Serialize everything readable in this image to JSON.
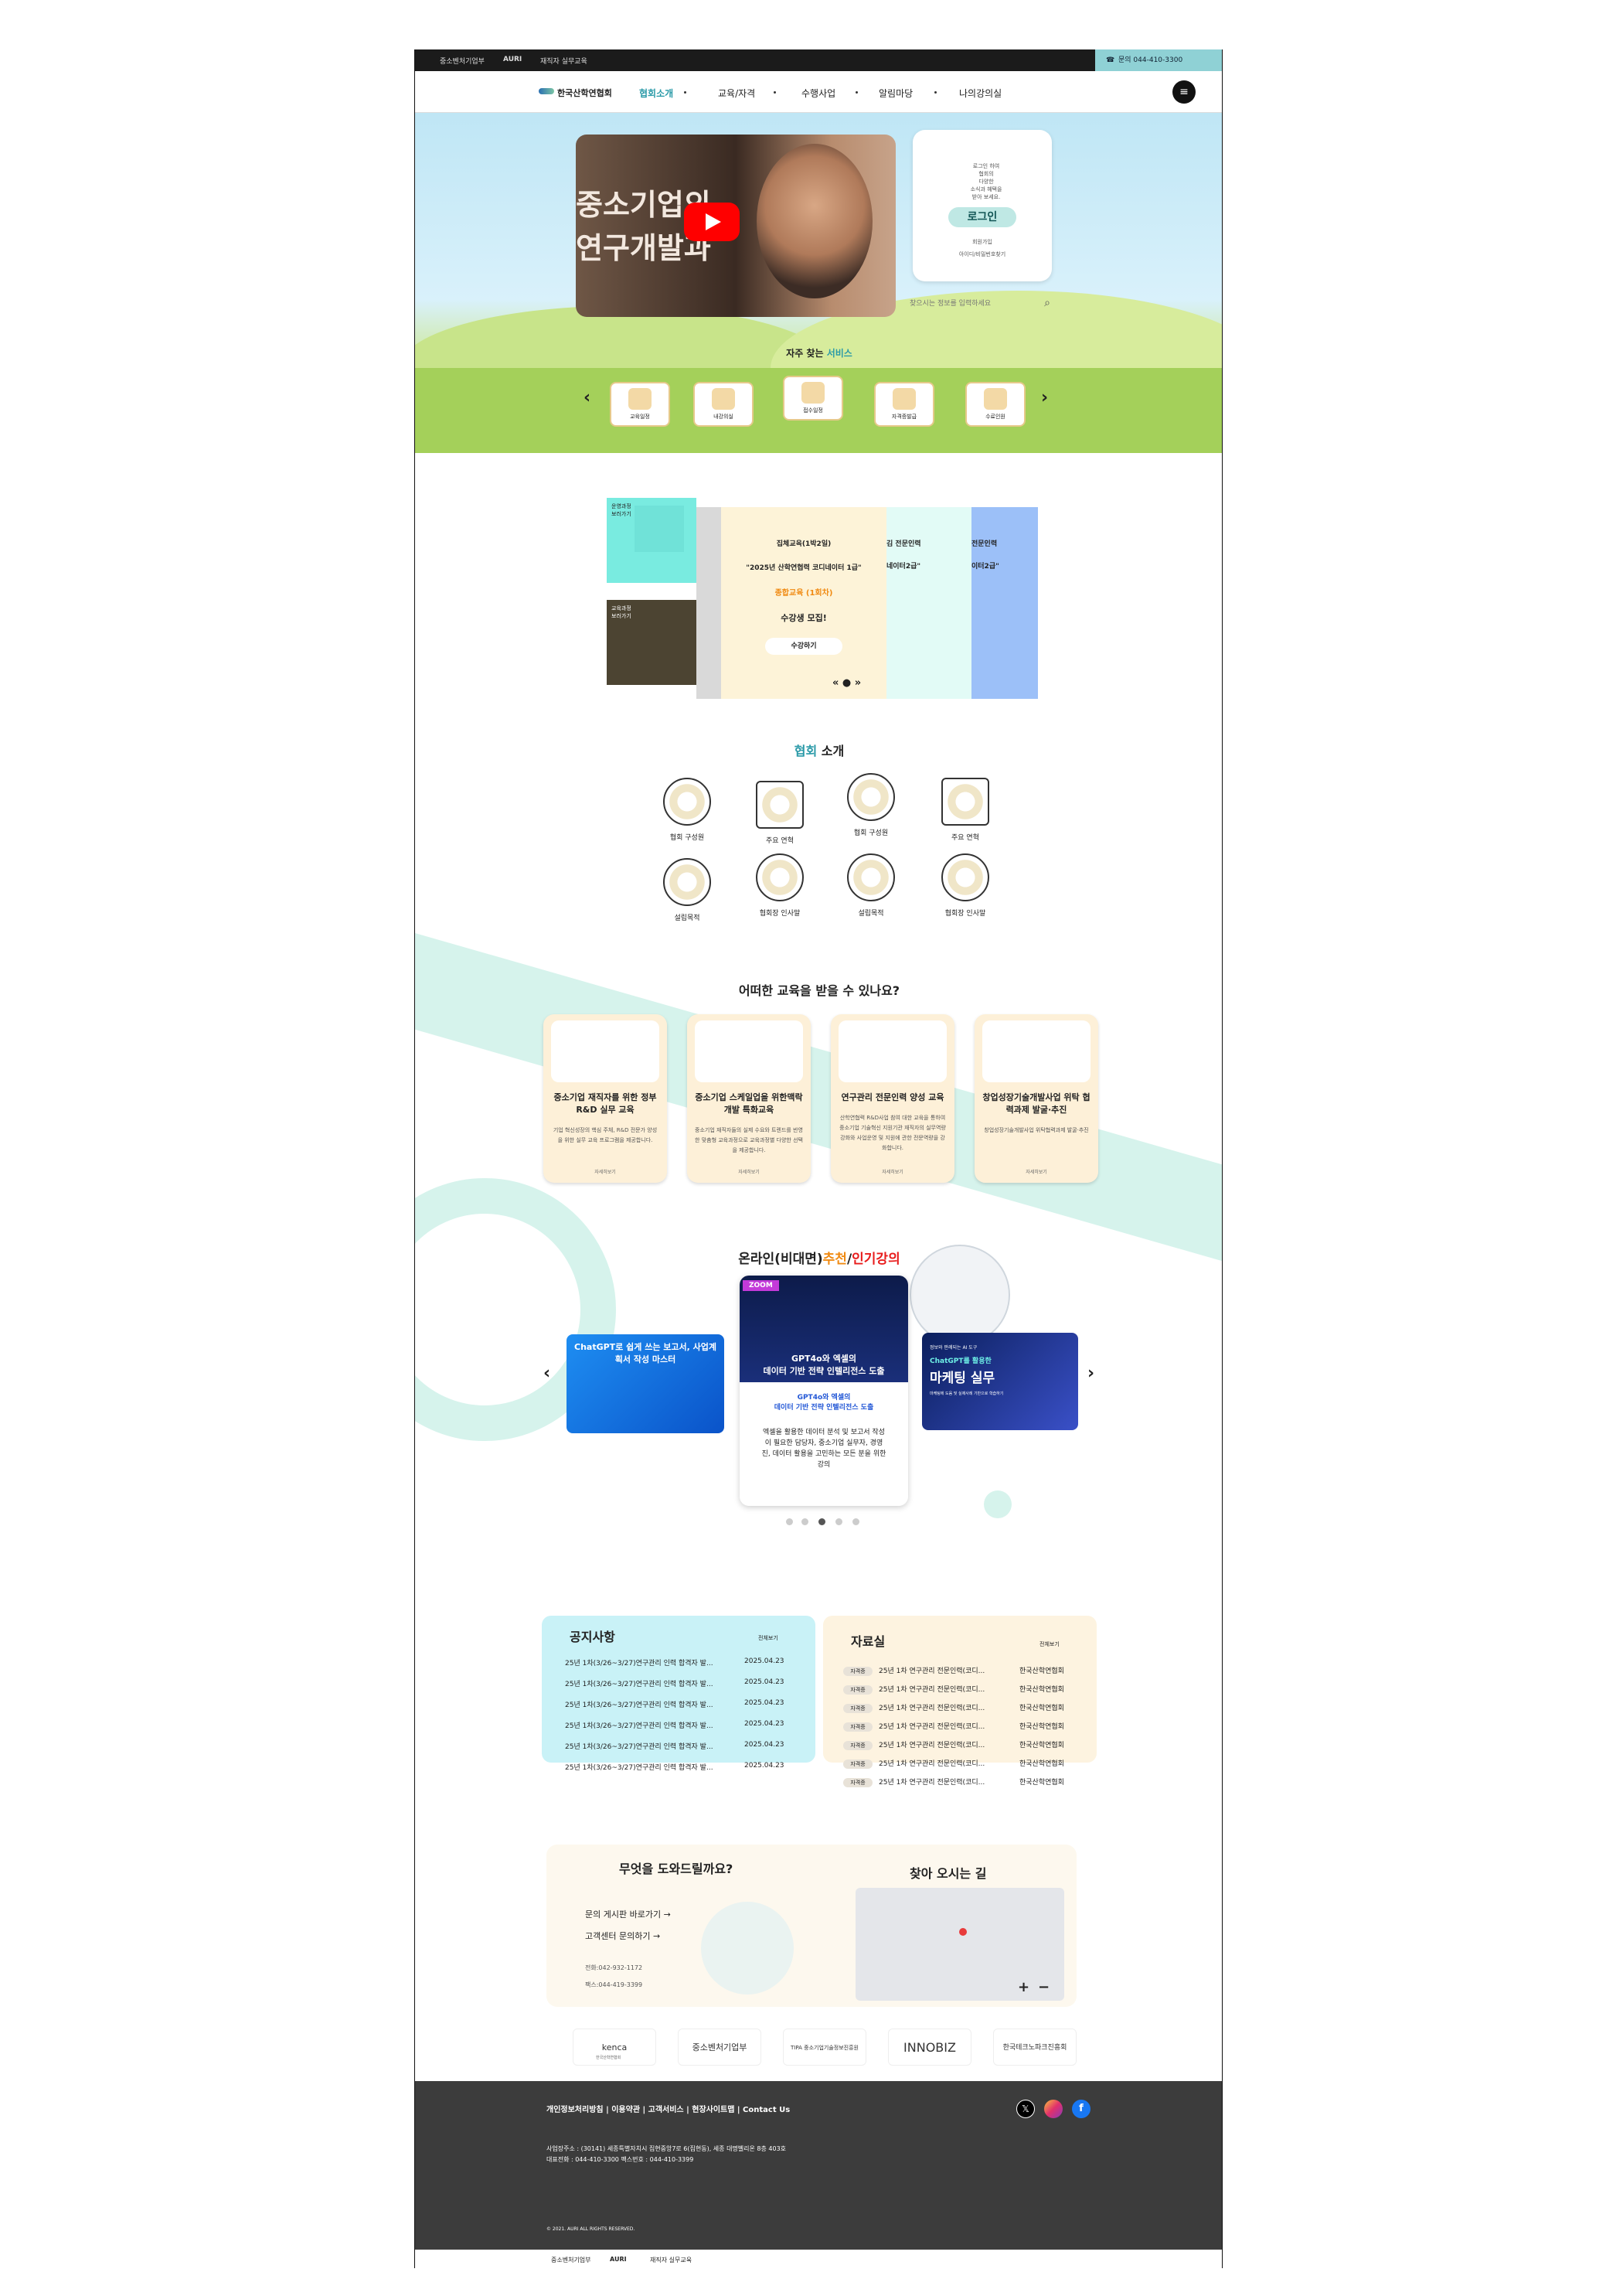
{
  "topbar": {
    "logo1": "중소벤처기업부",
    "logo2": "AURI",
    "logo3": "재직자 실무교육",
    "phone": "문의 044-410-3300"
  },
  "nav": {
    "logo": "한국산학연협회",
    "items": [
      "협회소개",
      "교육/자격",
      "수행사업",
      "알림마당",
      "나의강의실"
    ]
  },
  "hero": {
    "video_text_1": "중소기업의",
    "video_text_2": "연구개발과",
    "login_text": [
      "로그인 하여",
      "협회의",
      "다양한",
      "소식과 혜택을",
      "받아 보세요."
    ],
    "login_button": "로그인",
    "login_links": [
      "회원가입",
      "아이디/비밀번호찾기"
    ],
    "search_placeholder": "찾으시는 정보를 입력하세요",
    "services_title_1": "자주 찾는",
    "services_title_2": "서비스",
    "services": [
      "교육일정",
      "내강의실",
      "접수일정",
      "자격증발급",
      "수료인원"
    ]
  },
  "slider": {
    "side_top": "운영과정\n보러가기",
    "side_bottom": "교육과정\n보러가기",
    "line1": "집체교육(1박2일)",
    "line2": "\"2025년 산학연협력 코디네이터 1급\"",
    "line3": "종합교육 (1회차)",
    "line4": "수강생 모집!",
    "button": "수강하기",
    "peek1": "김 전문인력",
    "peek1b": "네이터2급\"",
    "peek2": "전문인력",
    "peek2b": "이터2급\"",
    "controls": "« ● »"
  },
  "about": {
    "title_1": "협회",
    "title_2": "소개",
    "items": [
      "협회 구성원",
      "주요 연혁",
      "협회 구성원",
      "주요 연혁",
      "설립목적",
      "협회장 인사말",
      "설립목적",
      "협회장 인사말"
    ]
  },
  "education": {
    "title": "어떠한 교육을 받을 수 있나요?",
    "cards": [
      {
        "title": "중소기업 재직자를 위한 정부 R&D 실무 교육",
        "desc": "기업 혁신성장의 핵심 주체, R&D 전문가 양성을 위한 실무 교육 프로그램을 제공합니다.",
        "more": "자세히보기"
      },
      {
        "title": "중소기업 스케일업을 위한맥락개발 특화교육",
        "desc": "중소기업 재직자들의 실제 수요와 트렌드를 반영한 맞춤형 교육과정으로 교육과정별 다양한 선택을 제공합니다.",
        "more": "자세히보기"
      },
      {
        "title": "연구관리 전문인력 양성 교육",
        "desc": "산학연협력 R&D사업 참여 대한 교육을 통하여 중소기업 기술혁신 지원기관 재직자의 실무역량 강화와 사업운영 및 지원에 관한 전문역량을 강화합니다.",
        "more": "자세히보기"
      },
      {
        "title": "창업성장기술개발사업 위탁 협력과제 발굴·추진",
        "desc": "창업성장기술개발사업 위탁협력과제 발굴·추진",
        "more": "자세히보기"
      }
    ]
  },
  "online": {
    "title_1": "온라인(비대면)",
    "title_2": "추천",
    "title_3": "/",
    "title_4": "인기강의",
    "left_course": "ChatGPT로 쉽게 쓰는 보고서, 사업계획서 작성 마스터",
    "center_badge": "ZOOM",
    "center_banner": "GPT4o와 엑셀의\n데이터 기반 전략 인텔리전스 도출",
    "center_title": "GPT4o와 엑셀의\n데이터 기반 전략 인텔리전스 도출",
    "center_desc": "엑셀을 활용한 데이터 분석 및 보고서 작성이 필요한 담당자, 중소기업 실무자, 경영진, 데이터 활용을 고민하는 모든 분을 위한 강의",
    "right_top": "정보와 판례되는 AI 도구",
    "right_title": "ChatGPT를 활용한",
    "right_main": "마케팅 실무",
    "right_sub": "마케팅에 도움 및 실제사례 기반으로 학습하기"
  },
  "notice": {
    "title": "공지사항",
    "more": "전체보기",
    "rows": [
      {
        "text": "25년 1차(3/26~3/27)연구관리 인력 합격자 발...",
        "date": "2025.04.23"
      },
      {
        "text": "25년 1차(3/26~3/27)연구관리 인력 합격자 발...",
        "date": "2025.04.23"
      },
      {
        "text": "25년 1차(3/26~3/27)연구관리 인력 합격자 발...",
        "date": "2025.04.23"
      },
      {
        "text": "25년 1차(3/26~3/27)연구관리 인력 합격자 발...",
        "date": "2025.04.23"
      },
      {
        "text": "25년 1차(3/26~3/27)연구관리 인력 합격자 발...",
        "date": "2025.04.23"
      },
      {
        "text": "25년 1차(3/26~3/27)연구관리 인력 합격자 발...",
        "date": "2025.04.23"
      }
    ]
  },
  "library": {
    "title": "자료실",
    "more": "전체보기",
    "rows": [
      {
        "tag": "자격증",
        "text": "25년 1차 연구관리 전문인력(코디...",
        "org": "한국산학연협회"
      },
      {
        "tag": "자격증",
        "text": "25년 1차 연구관리 전문인력(코디...",
        "org": "한국산학연협회"
      },
      {
        "tag": "자격증",
        "text": "25년 1차 연구관리 전문인력(코디...",
        "org": "한국산학연협회"
      },
      {
        "tag": "자격증",
        "text": "25년 1차 연구관리 전문인력(코디...",
        "org": "한국산학연협회"
      },
      {
        "tag": "자격증",
        "text": "25년 1차 연구관리 전문인력(코디...",
        "org": "한국산학연협회"
      },
      {
        "tag": "자격증",
        "text": "25년 1차 연구관리 전문인력(코디...",
        "org": "한국산학연협회"
      },
      {
        "tag": "자격증",
        "text": "25년 1차 연구관리 전문인력(코디...",
        "org": "한국산학연협회"
      }
    ]
  },
  "help": {
    "title": "무엇을 도와드릴까요?",
    "link1": "문의 게시판 바로가기 →",
    "link2": "고객센터 문의하기 →",
    "phone": "전화:042-932-1172",
    "fax": "팩스:044-419-3399",
    "map_title": "찾아 오시는 길"
  },
  "partners": [
    "kenca",
    "중소벤처기업부",
    "TIPA 중소기업기술정보진흥원",
    "INNOBIZ",
    "한국테크노파크진흥회"
  ],
  "partners_sub": "한국산학연협회",
  "footer": {
    "links": "개인정보처리방침  |  이용약관  |  고객서비스  |  현장사이트맵  |  Contact Us",
    "address": "사업장주소 : (30141) 세종특별자치시 집현중앙7로 6(집현동), 세종 대명벨리온 8층 403호",
    "contact": "대표전화 : 044-410-3300 팩스번호 : 044-410-3399",
    "copyright": "© 2021. AURI ALL RIGHTS RESERVED."
  },
  "bottombar": {
    "logo1": "중소벤처기업부",
    "logo2": "AURI",
    "logo3": "재직자 실무교육"
  },
  "colors": {
    "accent": "#8fd1d5",
    "hero_sky": "#bfe6f5",
    "grass": "#a9d35f",
    "footer": "#3c3c3c",
    "youtube": "#ff0000"
  },
  "icons": [
    "phone-icon",
    "menu-icon",
    "search-icon",
    "youtube-play-icon",
    "chevron-left-icon",
    "chevron-right-icon",
    "x-icon",
    "instagram-icon",
    "facebook-icon"
  ]
}
